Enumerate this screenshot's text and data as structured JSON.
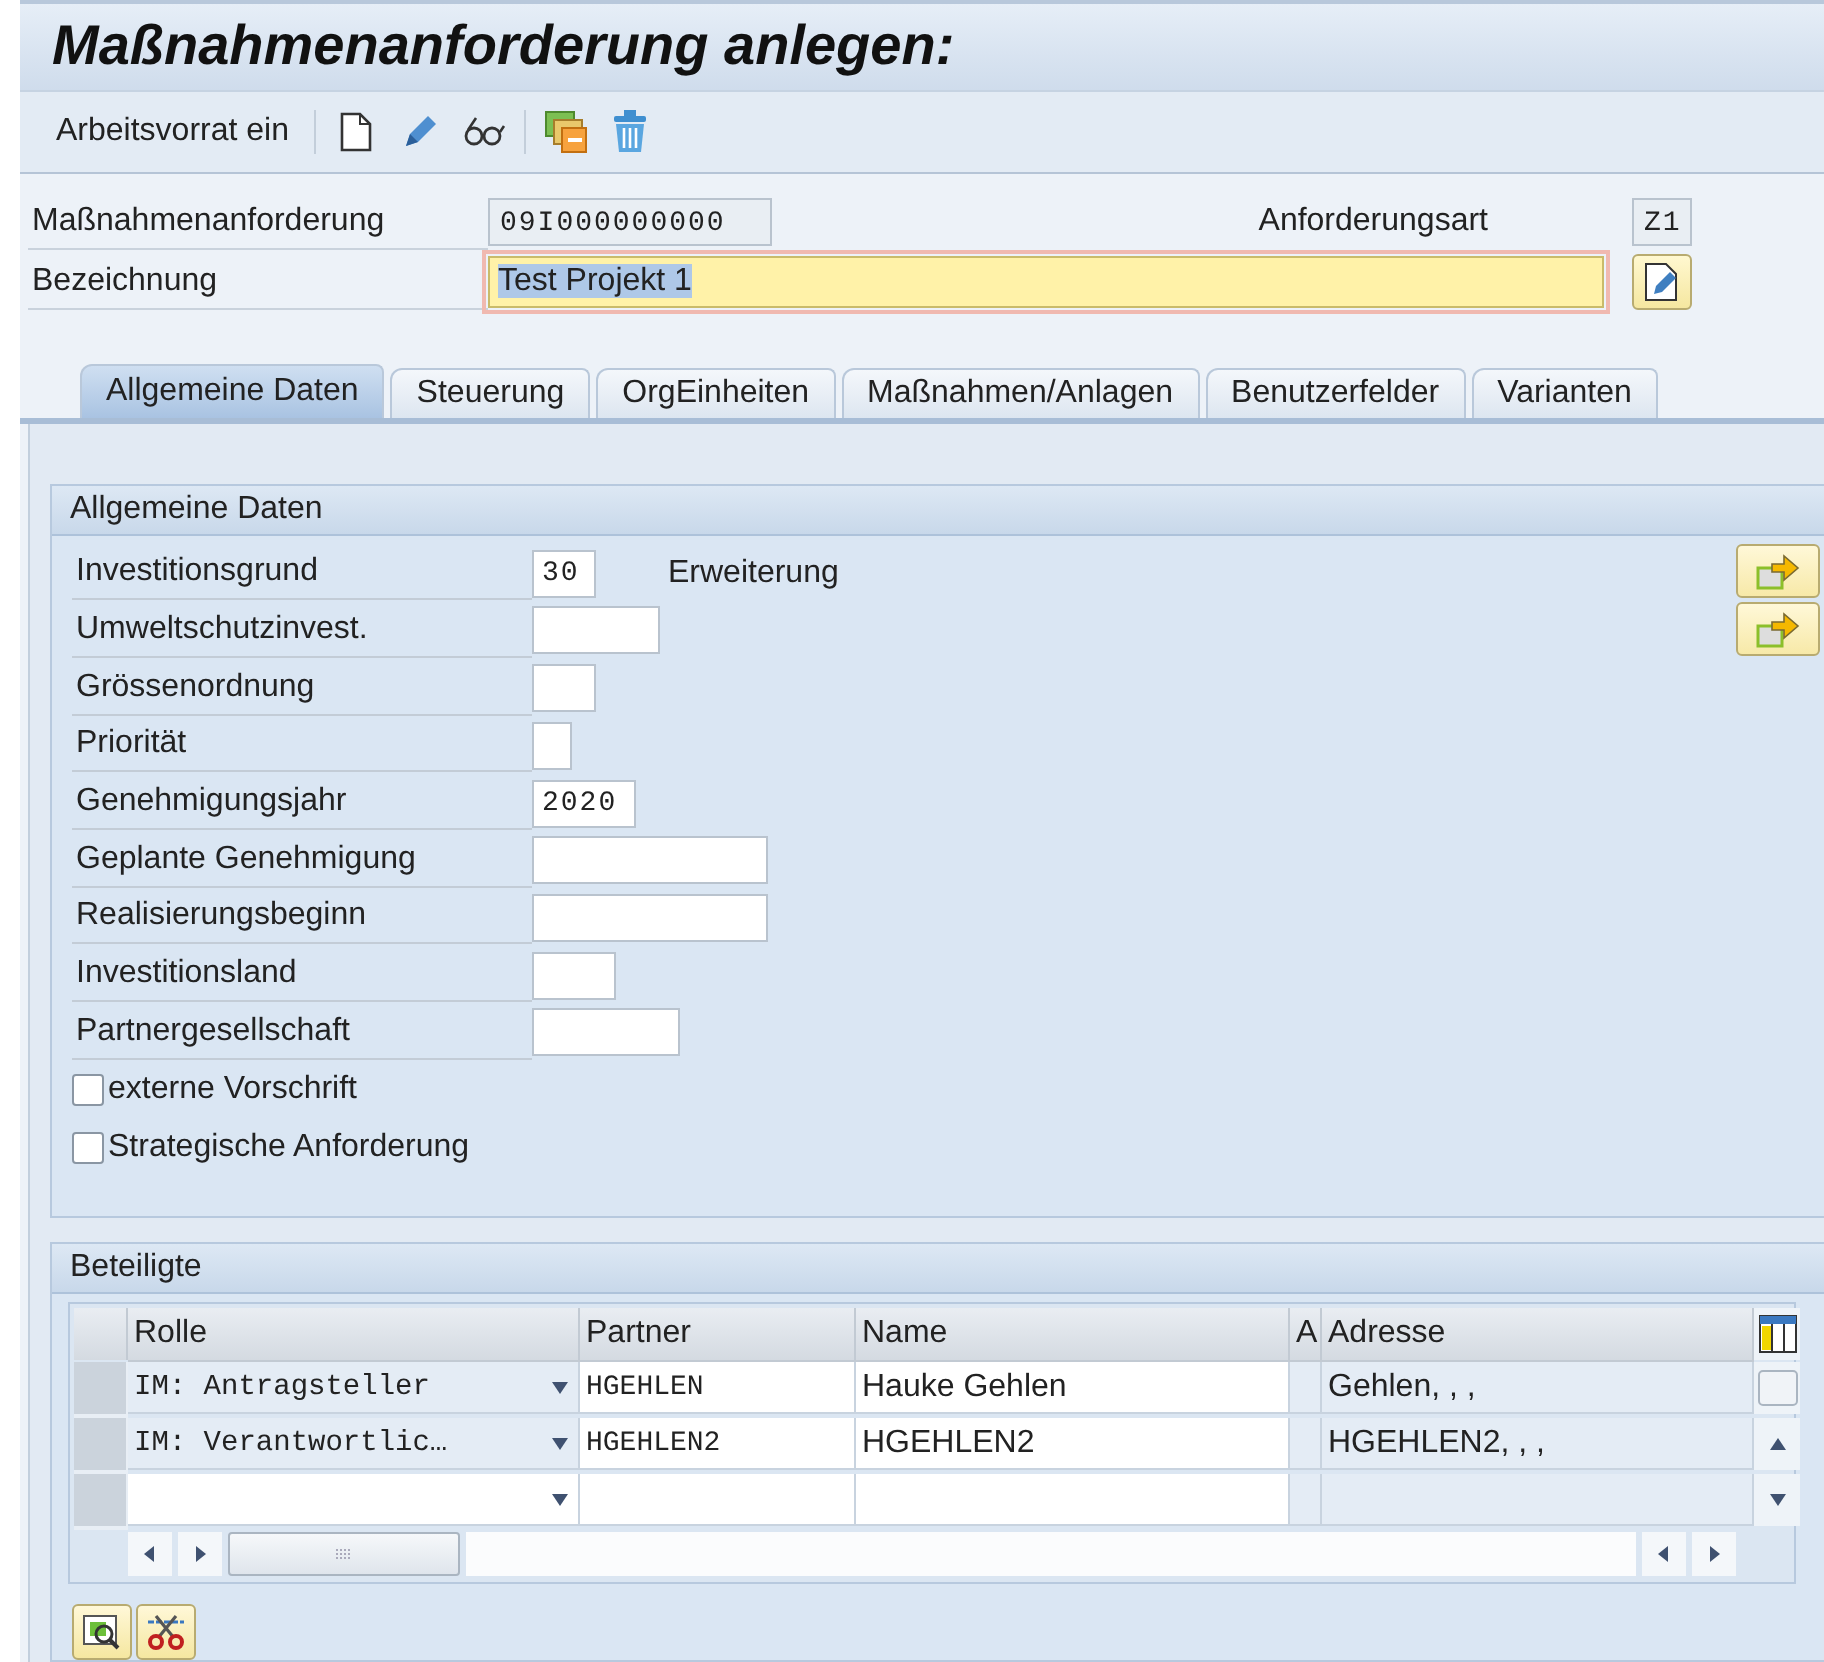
{
  "window": {
    "title": "Maßnahmenanforderung anlegen:"
  },
  "toolbar": {
    "label": "Arbeitsvorrat ein",
    "icons": [
      {
        "kind": "new"
      },
      {
        "kind": "edit"
      },
      {
        "kind": "display"
      },
      {
        "kind": "copy"
      },
      {
        "kind": "delete"
      }
    ]
  },
  "header": {
    "request": {
      "label": "Maßnahmenanforderung",
      "value": "09I000000000"
    },
    "type": {
      "label": "Anforderungsart",
      "value": "Z1"
    },
    "description": {
      "label": "Bezeichnung",
      "value": "Test Projekt 1",
      "focused": true
    }
  },
  "tabs": [
    {
      "label": "Allgemeine Daten",
      "selected": true
    },
    {
      "label": "Steuerung",
      "selected": false
    },
    {
      "label": "OrgEinheiten",
      "selected": false
    },
    {
      "label": "Maßnahmen/Anlagen",
      "selected": false
    },
    {
      "label": "Benutzerfelder",
      "selected": false
    },
    {
      "label": "Varianten",
      "selected": false
    }
  ],
  "general": {
    "title": "Allgemeine Daten",
    "fields": [
      {
        "label": "Investitionsgrund",
        "value": "30",
        "description": "Erweiterung"
      },
      {
        "label": "Umweltschutzinvest."
      },
      {
        "label": "Grössenordnung"
      },
      {
        "label": "Priorität"
      },
      {
        "label": "Genehmigungsjahr",
        "value": "2020"
      },
      {
        "label": "Geplante Genehmigung"
      },
      {
        "label": "Realisierungsbeginn"
      },
      {
        "label": "Investitionsland"
      },
      {
        "label": "Partnergesellschaft"
      }
    ],
    "checkboxes": [
      {
        "label": "externe Vorschrift",
        "checked": false
      },
      {
        "label": "Strategische Anforderung",
        "checked": false
      }
    ]
  },
  "participants": {
    "title": "Beteiligte",
    "columns": [
      "Rolle",
      "Partner",
      "Name",
      "A",
      "Adresse"
    ],
    "rows": [
      {
        "role": "IM: Antragsteller",
        "partner": "HGEHLEN",
        "name": "Hauke Gehlen",
        "address": "Gehlen, , ,"
      },
      {
        "role": "IM: Verantwortlic…",
        "partner": "HGEHLEN2",
        "name": "HGEHLEN2",
        "address": "HGEHLEN2, , ,"
      }
    ]
  }
}
